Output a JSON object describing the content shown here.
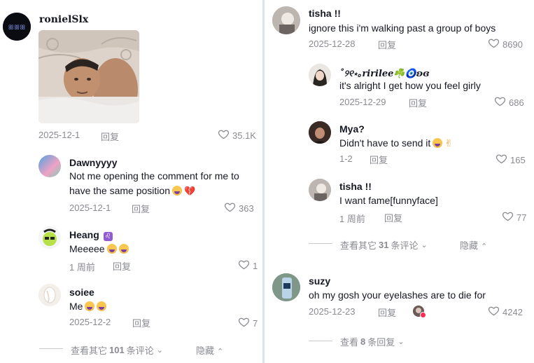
{
  "left": {
    "top_comment": {
      "username": "ronielSlx",
      "date": "2025-12-1",
      "reply_label": "回复",
      "likes": "35.1K"
    },
    "comments": [
      {
        "username": "Dawnyyyy",
        "text_line1": "Not me opening the comment for me to",
        "text_line2": "have the same position",
        "date": "2025-12-1",
        "reply_label": "回复",
        "likes": "363"
      },
      {
        "username": "Heang",
        "badge": "♌",
        "text": "Meeeee",
        "date": "1 周前",
        "reply_label": "回复",
        "likes": "1"
      },
      {
        "username": "soiee",
        "text": "Me",
        "date": "2025-12-2",
        "reply_label": "回复",
        "likes": "7"
      }
    ],
    "view_more": {
      "prefix": "查看其它",
      "count": "101",
      "suffix": "条评论"
    },
    "hide_label": "隐藏"
  },
  "right": {
    "main_comment": {
      "username": "tisha !!",
      "text": "ignore this i'm walking past a group of boys",
      "date": "2025-12-28",
      "reply_label": "回复",
      "likes": "8690"
    },
    "replies": [
      {
        "username": "˚୨୧⋆｡ririlee☘️🧿ʚɞ",
        "text": "it's alright I get how you feel girly",
        "date": "2025-12-29",
        "reply_label": "回复",
        "likes": "686"
      },
      {
        "username": "Mya?",
        "text": "Didn't have to send it",
        "date": "1-2",
        "reply_label": "回复",
        "likes": "165"
      },
      {
        "username": "tisha !!",
        "text": "I want fame[funnyface]",
        "date": "1 周前",
        "reply_label": "回复",
        "likes": "77"
      }
    ],
    "view_more": {
      "prefix": "查看其它",
      "count": "31",
      "suffix": "条评论"
    },
    "hide_label": "隐藏",
    "second_comment": {
      "username": "suzy",
      "text": "oh my gosh your eyelashes are to die for",
      "date": "2025-12-23",
      "reply_label": "回复",
      "likes": "4242"
    },
    "view_replies": {
      "prefix": "查看",
      "count": "8",
      "suffix": "条回复"
    }
  }
}
